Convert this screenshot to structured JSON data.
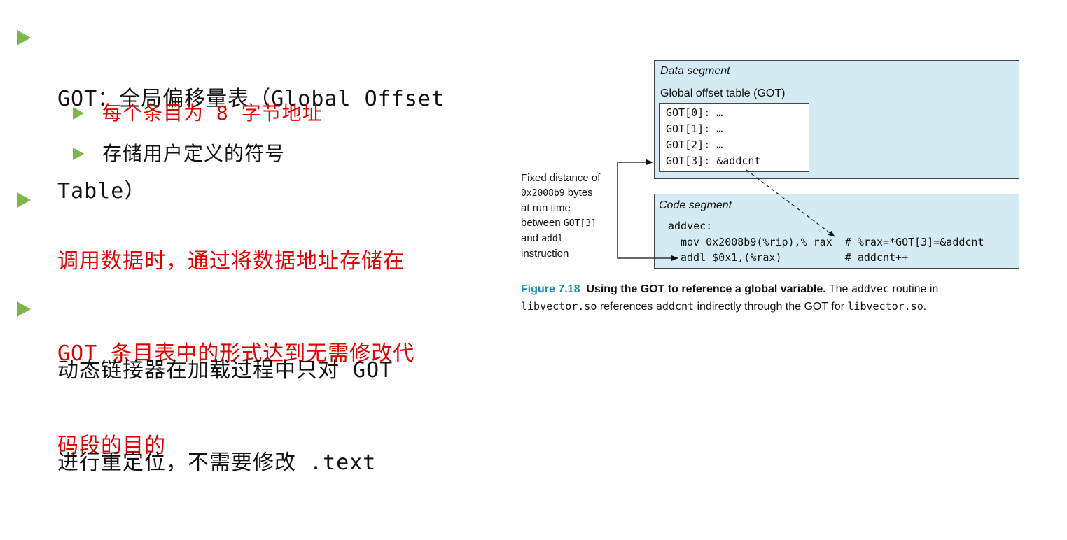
{
  "bullets": [
    {
      "text": "GOT：全局偏移量表（Global Offset Table）",
      "color": "#111111"
    },
    {
      "text": "每个条目为 8 字节地址",
      "color": "#e00000"
    },
    {
      "text": "存储用户定义的符号",
      "color": "#111111"
    },
    {
      "text": "调用数据时，通过将数据地址存储在 GOT 条目表中的形式达到无需修改代码段的目的",
      "color": "#e00000"
    },
    {
      "text": "动态链接器在加载过程中只对 GOT 进行重定位，不需要修改 .text",
      "color": "#111111"
    }
  ],
  "bullet_lines": {
    "b1a": "GOT：全局偏移量表（Global Offset",
    "b1b": "Table）",
    "b4a": "调用数据时，通过将数据地址存储在",
    "b4b": "GOT 条目表中的形式达到无需修改代",
    "b4c": "码段的目的",
    "b5a": "动态链接器在加载过程中只对 GOT",
    "b5b": "进行重定位，不需要修改 .text"
  },
  "figure": {
    "data_segment_title": "Data segment",
    "got_title": "Global offset table (GOT)",
    "got_entries": [
      "GOT[0]: …",
      "GOT[1]: …",
      "GOT[2]: …",
      "GOT[3]: &addcnt"
    ],
    "code_segment_title": "Code segment",
    "code_label": "addvec:",
    "code_line1": "mov 0x2008b9(%rip),% rax  # %rax=*GOT[3]=&addcnt",
    "code_line2": "addl $0x1,(%rax)          # addcnt++",
    "side_note": {
      "l1": "Fixed distance of",
      "l2": "0x2008b9",
      "l2b": " bytes",
      "l3": "at run time",
      "l4": "between ",
      "l4b": "GOT[3]",
      "l5": "and ",
      "l5b": "addl",
      "l6": "instruction"
    },
    "caption": {
      "label": "Figure 7.18",
      "bold": "Using the GOT to reference a global variable.",
      "t1": " The ",
      "m1": "addvec",
      "t2": " routine in",
      "m2": "libvector.so",
      "t3": " references ",
      "m3": "addcnt",
      "t4": " indirectly through the GOT for ",
      "m4": "libvector.so",
      "t5": "."
    }
  },
  "colors": {
    "bullet": "#7ab648",
    "segment_fill": "#d4ebf3",
    "caption_label": "#1a8cbf",
    "highlight": "#e00000"
  }
}
